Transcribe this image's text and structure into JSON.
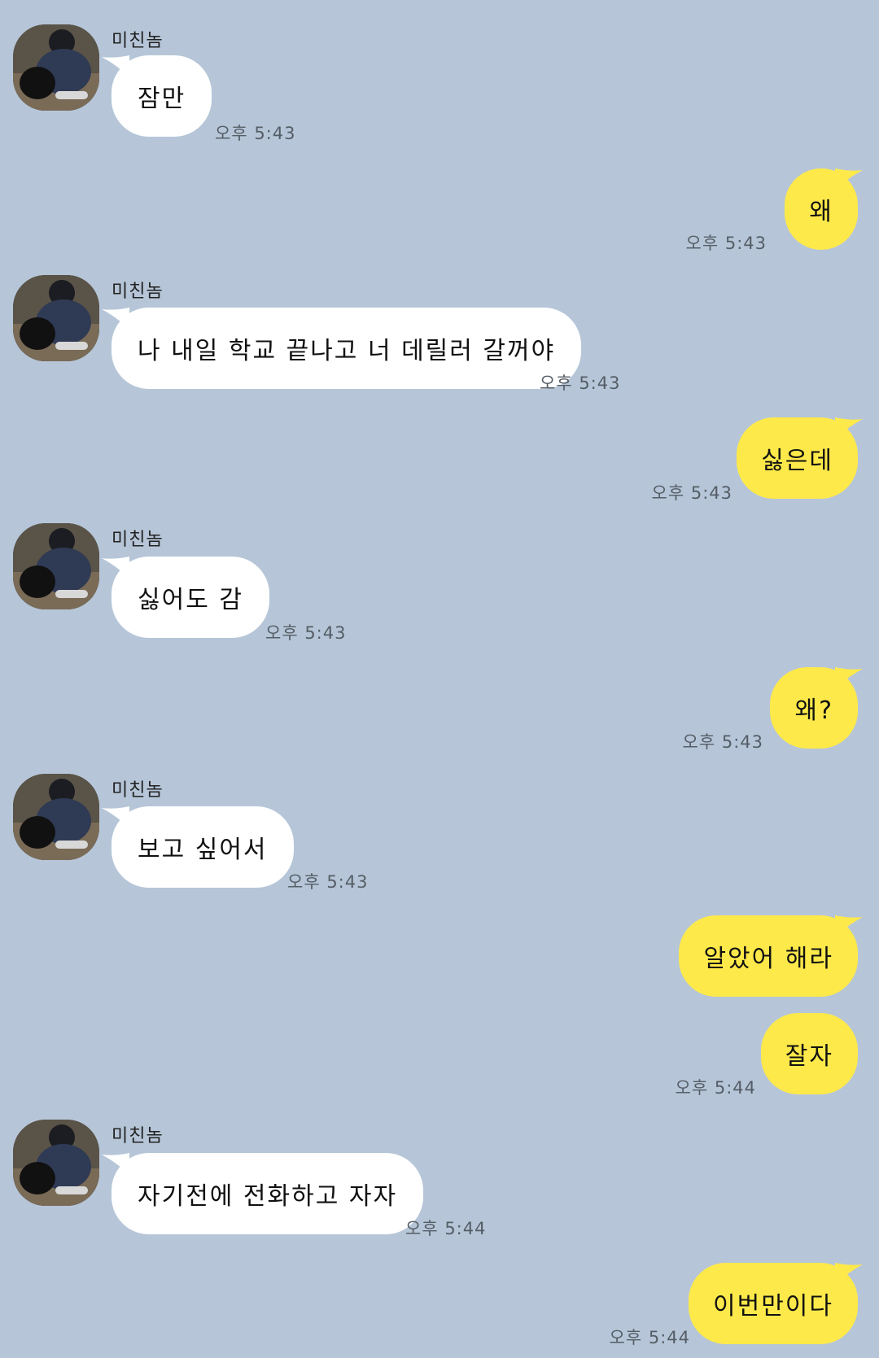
{
  "colors": {
    "background": "#b6c6d8",
    "incoming_bubble": "#ffffff",
    "outgoing_bubble": "#fee94a",
    "timestamp": "#555d66"
  },
  "messages": [
    {
      "direction": "in",
      "sender": "미친놈",
      "text": "잠만",
      "time": "오후 5:43"
    },
    {
      "direction": "out",
      "text": "왜",
      "time": "오후 5:43"
    },
    {
      "direction": "in",
      "sender": "미친놈",
      "text": "나 내일 학교 끝나고 너 데릴러 갈꺼야",
      "time": "오후 5:43"
    },
    {
      "direction": "out",
      "text": "싫은데",
      "time": "오후 5:43"
    },
    {
      "direction": "in",
      "sender": "미친놈",
      "text": "싫어도 감",
      "time": "오후 5:43"
    },
    {
      "direction": "out",
      "text": "왜?",
      "time": "오후 5:43"
    },
    {
      "direction": "in",
      "sender": "미친놈",
      "text": "보고 싶어서",
      "time": "오후 5:43"
    },
    {
      "direction": "out",
      "text": "알았어 해라",
      "time": ""
    },
    {
      "direction": "out",
      "text": "잘자",
      "time": "오후 5:44"
    },
    {
      "direction": "in",
      "sender": "미친놈",
      "text": "자기전에 전화하고 자자",
      "time": "오후 5:44"
    },
    {
      "direction": "out",
      "text": "이번만이다",
      "time": "오후 5:44"
    }
  ]
}
